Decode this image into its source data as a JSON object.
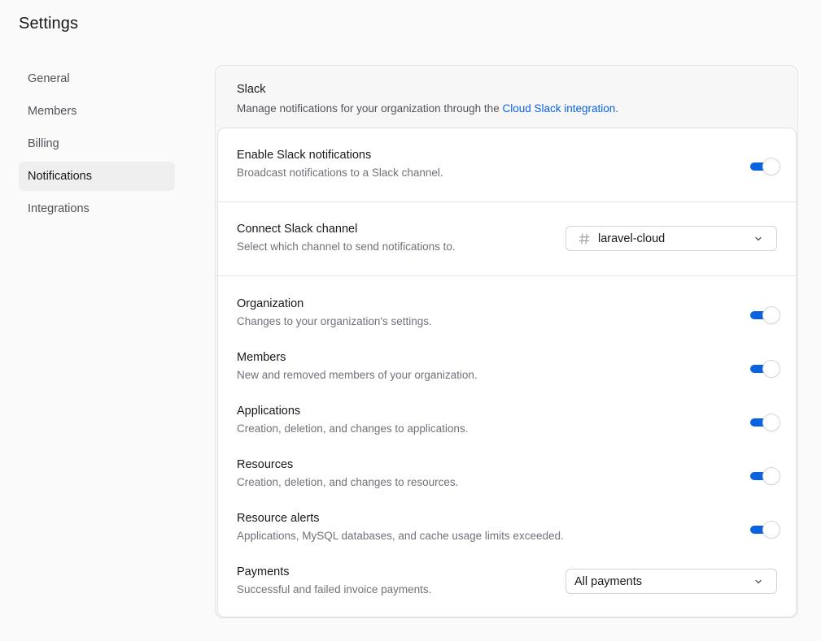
{
  "page": {
    "title": "Settings"
  },
  "sidebar": {
    "items": [
      {
        "label": "General"
      },
      {
        "label": "Members"
      },
      {
        "label": "Billing"
      },
      {
        "label": "Notifications",
        "active": true
      },
      {
        "label": "Integrations"
      }
    ]
  },
  "slack": {
    "title": "Slack",
    "description_prefix": "Manage notifications for your organization through the ",
    "description_link": "Cloud Slack integration",
    "description_suffix": ".",
    "enable": {
      "title": "Enable Slack notifications",
      "description": "Broadcast notifications to a Slack channel.",
      "enabled": true
    },
    "channel": {
      "title": "Connect Slack channel",
      "description": "Select which channel to send notifications to.",
      "selected": "laravel-cloud",
      "icon": "hash-icon"
    },
    "events": [
      {
        "title": "Organization",
        "description": "Changes to your organization's settings.",
        "enabled": true
      },
      {
        "title": "Members",
        "description": "New and removed members of your organization.",
        "enabled": true
      },
      {
        "title": "Applications",
        "description": "Creation, deletion, and changes to applications.",
        "enabled": true
      },
      {
        "title": "Resources",
        "description": "Creation, deletion, and changes to resources.",
        "enabled": true
      },
      {
        "title": "Resource alerts",
        "description": "Applications, MySQL databases, and cache usage limits exceeded.",
        "enabled": true
      }
    ],
    "payments": {
      "title": "Payments",
      "description": "Successful and failed invoice payments.",
      "selected": "All payments"
    }
  },
  "colors": {
    "accent": "#0a62e0",
    "link": "#0a62e0",
    "active_nav_bg": "#efeff0"
  }
}
